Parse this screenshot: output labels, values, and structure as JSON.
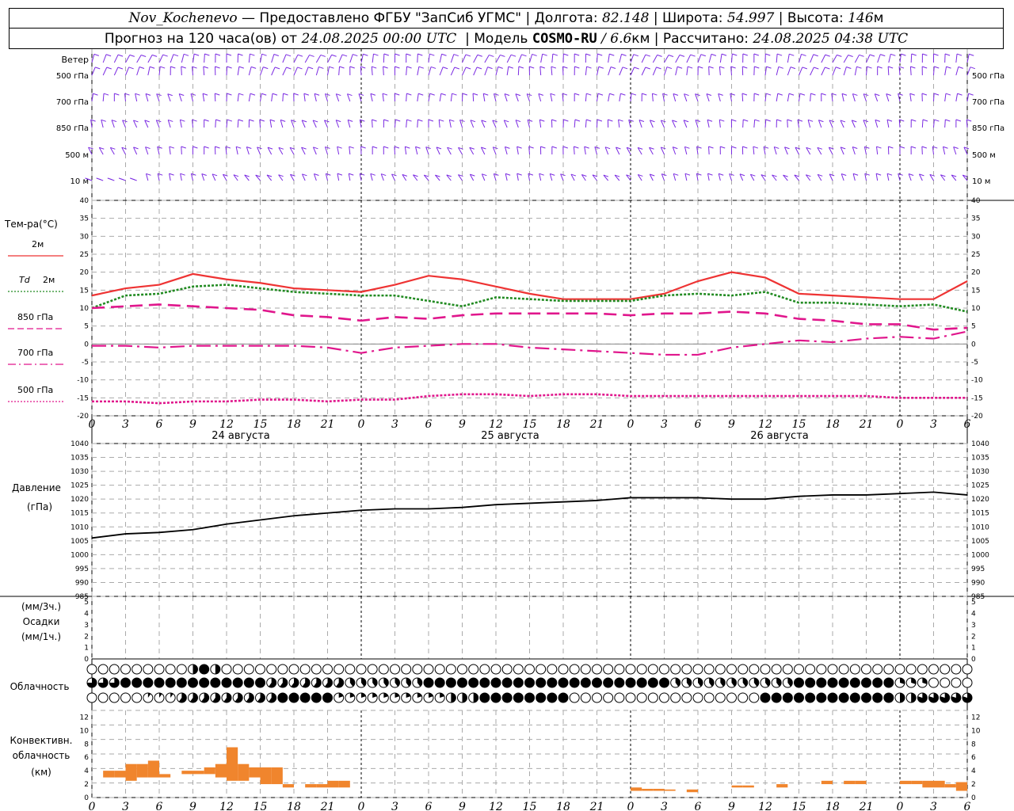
{
  "header": {
    "station": "Nov_Kochenevo",
    "provider": " — Предоставлено ФГБУ \"ЗапСиб УГМС\" | ",
    "lon_label": "Долгота: ",
    "lon": "82.148",
    "lat_label": " | Широта: ",
    "lat": "54.997",
    "alt_label": " | Высота: ",
    "alt": "146",
    "alt_unit": "м",
    "fc_label": "Прогноз на 120 часа(ов) от ",
    "fc_time": "24.08.2025 00:00 UTC",
    "model_label": "  | Модель ",
    "model": "COSMO-RU",
    "model_res": " / 6.6",
    "model_res_unit": "км",
    "calc_label": " | Рассчитано: ",
    "calc_time": "24.08.2025 04:38 UTC"
  },
  "wind_panel": {
    "title": "Ветер",
    "levels": [
      "500 гПа",
      "700 гПа",
      "850 гПа",
      "500  м",
      "10  м"
    ],
    "right_levels": [
      "500 гПа",
      "700 гПа",
      "850 гПа",
      "500  м",
      "10  м"
    ],
    "barb_color": "#7b2be2"
  },
  "temp_panel": {
    "title": "Тем-ра(°С)",
    "yticks": [
      40,
      35,
      30,
      25,
      20,
      15,
      10,
      5,
      0,
      -5,
      -10,
      -15,
      -20
    ],
    "legend": [
      {
        "label": "2м",
        "color": "#ee3333",
        "style": "solid"
      },
      {
        "label": "Td  2м",
        "color": "#228b22",
        "style": "dotted"
      },
      {
        "label": "850 гПа",
        "color": "#e0168c",
        "style": "dashed"
      },
      {
        "label": "700 гПа",
        "color": "#e0168c",
        "style": "dashdot"
      },
      {
        "label": "500 гПа",
        "color": "#e0168c",
        "style": "dotted"
      }
    ]
  },
  "time_axis": {
    "hour_labels": [
      "0",
      "3",
      "6",
      "9",
      "12",
      "15",
      "18",
      "21",
      "0",
      "3",
      "6",
      "9",
      "12",
      "15",
      "18",
      "21",
      "0",
      "3",
      "6",
      "9",
      "12",
      "15",
      "18",
      "21",
      "0",
      "3",
      "6"
    ],
    "day_labels": [
      "24 августа",
      "25 августа",
      "26 августа"
    ]
  },
  "pressure_panel": {
    "title": "Давление",
    "unit": "(гПа)",
    "yticks": [
      1040,
      1035,
      1030,
      1025,
      1020,
      1015,
      1010,
      1005,
      1000,
      995,
      990,
      985
    ]
  },
  "precip_panel": {
    "label1": "(мм/3ч.)",
    "label2": "Осадки",
    "label3": "(мм/1ч.)",
    "yticks": [
      5,
      4,
      3,
      2,
      1,
      0
    ]
  },
  "cloud_panel": {
    "title": "Облачность"
  },
  "conv_panel": {
    "title1": "Конвективн.",
    "title2": "облачность",
    "title3": "(км)",
    "yticks": [
      12,
      10,
      8,
      6,
      4,
      2,
      0
    ],
    "color": "#f0852d"
  },
  "chart_data": [
    {
      "type": "line",
      "title": "Тем-ра(°С)",
      "x_unit": "hours since 24.08.2025 00:00 UTC",
      "ylim": [
        -20,
        40
      ],
      "series": [
        {
          "name": "2м",
          "x": [
            0,
            3,
            6,
            9,
            12,
            15,
            18,
            21,
            24,
            27,
            30,
            33,
            36,
            39,
            42,
            45,
            48,
            51,
            54,
            57,
            60,
            63,
            66,
            69,
            72,
            75,
            78
          ],
          "values": [
            13.5,
            15.5,
            16.5,
            19.5,
            18,
            17,
            15.5,
            15,
            14.5,
            16.5,
            19,
            18,
            16,
            14,
            12.5,
            12.5,
            12.5,
            14,
            17.5,
            20,
            18.5,
            14,
            13.5,
            13,
            12.5,
            12.5,
            17.5
          ]
        },
        {
          "name": "Td  2м",
          "x": [
            0,
            3,
            6,
            9,
            12,
            15,
            18,
            21,
            24,
            27,
            30,
            33,
            36,
            39,
            42,
            45,
            48,
            51,
            54,
            57,
            60,
            63,
            66,
            69,
            72,
            75,
            78
          ],
          "values": [
            10,
            13.5,
            14,
            16,
            16.5,
            15.5,
            14.5,
            14,
            13.5,
            13.5,
            12,
            10.5,
            13,
            12.5,
            12,
            12,
            12,
            13.5,
            14,
            13.5,
            14.5,
            11.5,
            11.5,
            11,
            10.5,
            11,
            9
          ]
        },
        {
          "name": "850 гПа",
          "x": [
            0,
            3,
            6,
            9,
            12,
            15,
            18,
            21,
            24,
            27,
            30,
            33,
            36,
            39,
            42,
            45,
            48,
            51,
            54,
            57,
            60,
            63,
            66,
            69,
            72,
            75,
            78
          ],
          "values": [
            10,
            10.5,
            11,
            10.5,
            10,
            9.5,
            8,
            7.5,
            6.5,
            7.5,
            7,
            8,
            8.5,
            8.5,
            8.5,
            8.5,
            8,
            8.5,
            8.5,
            9,
            8.5,
            7,
            6.5,
            5.5,
            5.5,
            4,
            4.5
          ]
        },
        {
          "name": "700 гПа",
          "x": [
            0,
            3,
            6,
            9,
            12,
            15,
            18,
            21,
            24,
            27,
            30,
            33,
            36,
            39,
            42,
            45,
            48,
            51,
            54,
            57,
            60,
            63,
            66,
            69,
            72,
            75,
            78
          ],
          "values": [
            -0.5,
            -0.5,
            -1,
            -0.5,
            -0.5,
            -0.5,
            -0.5,
            -1,
            -2.5,
            -1,
            -0.5,
            0,
            0,
            -1,
            -1.5,
            -2,
            -2.5,
            -3,
            -3,
            -1,
            0,
            1,
            0.5,
            1.5,
            2,
            1.5,
            3.5
          ]
        },
        {
          "name": "500 гПа",
          "x": [
            0,
            3,
            6,
            9,
            12,
            15,
            18,
            21,
            24,
            27,
            30,
            33,
            36,
            39,
            42,
            45,
            48,
            51,
            54,
            57,
            60,
            63,
            66,
            69,
            72,
            75,
            78
          ],
          "values": [
            -16,
            -16,
            -16.5,
            -16,
            -16,
            -15.5,
            -15.5,
            -16,
            -15.5,
            -15.5,
            -14.5,
            -14,
            -14,
            -14.5,
            -14,
            -14,
            -14.5,
            -14.5,
            -14.5,
            -14.5,
            -14.5,
            -14.5,
            -14.5,
            -14.5,
            -15,
            -15,
            -15
          ]
        }
      ]
    },
    {
      "type": "line",
      "title": "Давление (гПа)",
      "x_unit": "hours since 24.08.2025 00:00 UTC",
      "ylim": [
        985,
        1040
      ],
      "series": [
        {
          "name": "Давление",
          "x": [
            0,
            3,
            6,
            9,
            12,
            15,
            18,
            21,
            24,
            27,
            30,
            33,
            36,
            39,
            42,
            45,
            48,
            51,
            54,
            57,
            60,
            63,
            66,
            69,
            72,
            75,
            78
          ],
          "values": [
            1006,
            1007.5,
            1008,
            1009,
            1011,
            1012.5,
            1014,
            1015,
            1016,
            1016.5,
            1016.5,
            1017,
            1018,
            1018.5,
            1019,
            1019.5,
            1020.5,
            1020.5,
            1020.5,
            1020,
            1020,
            1021,
            1021.5,
            1021.5,
            1022,
            1022.5,
            1021.5
          ]
        }
      ]
    },
    {
      "type": "bar",
      "title": "Конвективн. облачность (км)",
      "x_unit": "hours since 24.08.2025 00:00 UTC",
      "ylim": [
        0,
        13
      ],
      "bars": [
        {
          "x": 1.5,
          "base": 3,
          "top": 4
        },
        {
          "x": 2.5,
          "base": 3,
          "top": 4
        },
        {
          "x": 3.5,
          "base": 2.5,
          "top": 5
        },
        {
          "x": 4.5,
          "base": 3,
          "top": 5
        },
        {
          "x": 5.5,
          "base": 3,
          "top": 5.5
        },
        {
          "x": 6.5,
          "base": 3,
          "top": 3.5
        },
        {
          "x": 8.5,
          "base": 3.5,
          "top": 4
        },
        {
          "x": 9.5,
          "base": 3.5,
          "top": 4
        },
        {
          "x": 10.5,
          "base": 3.5,
          "top": 4.5
        },
        {
          "x": 11.5,
          "base": 3,
          "top": 5
        },
        {
          "x": 12.5,
          "base": 2.5,
          "top": 7.5
        },
        {
          "x": 13.5,
          "base": 2.5,
          "top": 5
        },
        {
          "x": 14.5,
          "base": 3,
          "top": 4.5
        },
        {
          "x": 15.5,
          "base": 2,
          "top": 4.5
        },
        {
          "x": 16.5,
          "base": 2,
          "top": 4.5
        },
        {
          "x": 17.5,
          "base": 1.5,
          "top": 2
        },
        {
          "x": 19.5,
          "base": 1.5,
          "top": 2
        },
        {
          "x": 20.5,
          "base": 1.5,
          "top": 2
        },
        {
          "x": 21.5,
          "base": 1.5,
          "top": 2.5
        },
        {
          "x": 22.5,
          "base": 1.5,
          "top": 2.5
        },
        {
          "x": 48.5,
          "base": 1,
          "top": 1.5
        },
        {
          "x": 49.5,
          "base": 1,
          "top": 1.3
        },
        {
          "x": 50.5,
          "base": 1,
          "top": 1.3
        },
        {
          "x": 51.5,
          "base": 1,
          "top": 1.2
        },
        {
          "x": 53.5,
          "base": 0.8,
          "top": 1.2
        },
        {
          "x": 57.5,
          "base": 1.5,
          "top": 1.8
        },
        {
          "x": 58.5,
          "base": 1.5,
          "top": 1.8
        },
        {
          "x": 61.5,
          "base": 1.5,
          "top": 2
        },
        {
          "x": 65.5,
          "base": 2,
          "top": 2.5
        },
        {
          "x": 67.5,
          "base": 2,
          "top": 2.5
        },
        {
          "x": 68.5,
          "base": 2,
          "top": 2.5
        },
        {
          "x": 72.5,
          "base": 2,
          "top": 2.5
        },
        {
          "x": 73.5,
          "base": 2,
          "top": 2.5
        },
        {
          "x": 74.5,
          "base": 1.5,
          "top": 2.5
        },
        {
          "x": 75.5,
          "base": 1.5,
          "top": 2.5
        },
        {
          "x": 76.5,
          "base": 1.5,
          "top": 2
        },
        {
          "x": 77.5,
          "base": 1,
          "top": 2.3
        }
      ]
    }
  ]
}
